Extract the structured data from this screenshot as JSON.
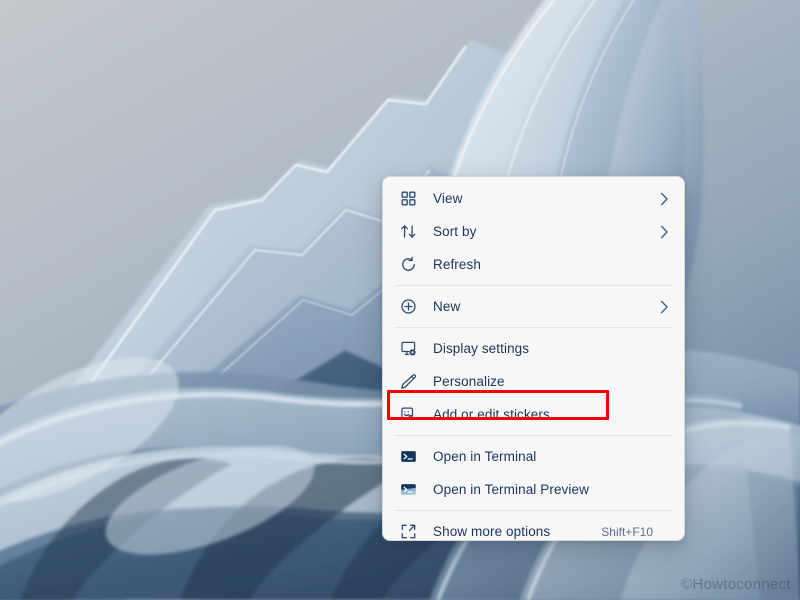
{
  "desktop": {
    "wallpaper_name": "windows-11-bloom-abstract-ribbons",
    "watermark": "©Howtoconnect"
  },
  "context_menu": {
    "name": "desktop-context-menu",
    "background_color": "#f7f7f7",
    "text_color": "#1b355b",
    "groups": [
      {
        "items": [
          {
            "id": "view",
            "label": "View",
            "icon": "grid-view-icon",
            "submenu": true,
            "accel": ""
          },
          {
            "id": "sort-by",
            "label": "Sort by",
            "icon": "sort-arrows-icon",
            "submenu": true,
            "accel": ""
          },
          {
            "id": "refresh",
            "label": "Refresh",
            "icon": "refresh-circular-arrow-icon",
            "submenu": false,
            "accel": ""
          }
        ]
      },
      {
        "items": [
          {
            "id": "new",
            "label": "New",
            "icon": "plus-circle-icon",
            "submenu": true,
            "accel": ""
          }
        ]
      },
      {
        "items": [
          {
            "id": "display-settings",
            "label": "Display settings",
            "icon": "monitor-gear-icon",
            "submenu": false,
            "accel": ""
          },
          {
            "id": "personalize",
            "label": "Personalize",
            "icon": "pencil-icon",
            "submenu": false,
            "accel": ""
          },
          {
            "id": "add-edit-stickers",
            "label": "Add or edit stickers",
            "icon": "sticker-smiley-icon",
            "submenu": false,
            "accel": "",
            "highlighted": true
          }
        ]
      },
      {
        "items": [
          {
            "id": "open-in-terminal",
            "label": "Open in Terminal",
            "icon": "terminal-icon",
            "submenu": false,
            "accel": ""
          },
          {
            "id": "open-in-terminal-preview",
            "label": "Open in Terminal Preview",
            "icon": "terminal-preview-icon",
            "submenu": false,
            "accel": ""
          }
        ]
      },
      {
        "items": [
          {
            "id": "show-more-options",
            "label": "Show more options",
            "icon": "expand-options-icon",
            "submenu": false,
            "accel": "Shift+F10"
          }
        ]
      }
    ]
  },
  "annotation": {
    "highlight_color": "#f50000",
    "target_item": "Add or edit stickers"
  }
}
